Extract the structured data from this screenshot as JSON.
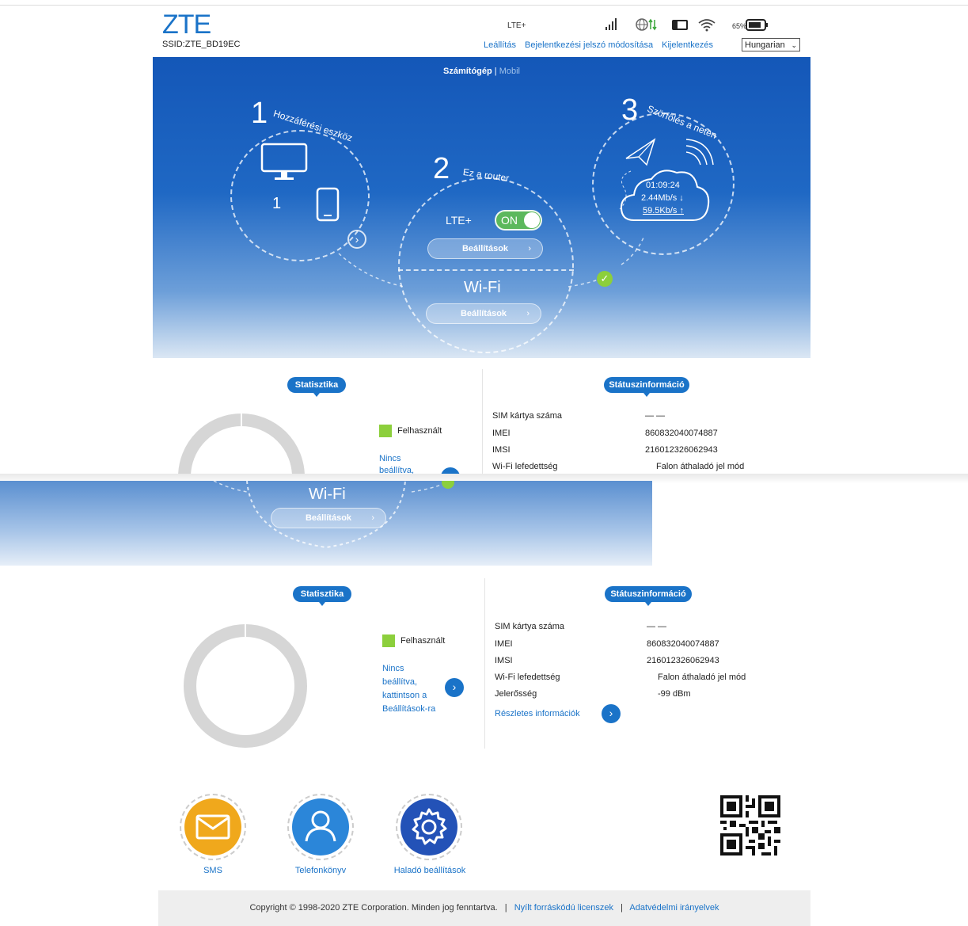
{
  "header": {
    "logo": "ZTE",
    "ssid": "SSID:ZTE_BD19EC",
    "network_type": "LTE+",
    "battery_percent": "65%",
    "links": [
      "Leállítás",
      "Bejelentkezési jelszó módosítása",
      "Kijelentkezés"
    ],
    "language": "Hungarian"
  },
  "mode_switch": {
    "active": "Számítógép",
    "separator": "|",
    "inactive": "Mobil"
  },
  "step1": {
    "number": "1",
    "title": "Hozzáférési eszköz",
    "device_count": "1"
  },
  "step2": {
    "number": "2",
    "title": "Ez a router",
    "lte_label": "LTE+",
    "toggle_label": "ON",
    "settings_label": "Beállítások",
    "wifi_label": "Wi-Fi",
    "wifi_settings_label": "Beállítások"
  },
  "step3": {
    "number": "3",
    "title": "Szörfölés a neten",
    "time": "01:09:24",
    "download": "2.44Mb/s ↓",
    "upload": "59.5Kb/s ↑"
  },
  "statistics": {
    "title": "Statisztika",
    "legend_used": "Felhasznált",
    "not_set_lines": [
      "Nincs",
      "beállítva,",
      "kattintson a",
      "Beállítások-ra"
    ]
  },
  "status": {
    "title": "Státuszinformáció",
    "rows": [
      {
        "label": "SIM kártya száma",
        "value": "— —"
      },
      {
        "label": "IMEI",
        "value": "860832040074887"
      },
      {
        "label": "IMSI",
        "value": "216012326062943"
      },
      {
        "label": "Wi-Fi lefedettség",
        "value": "Falon áthaladó jel mód"
      },
      {
        "label": "Jelerősség",
        "value": "-99 dBm"
      }
    ],
    "details_link": "Részletes információk"
  },
  "apps": [
    {
      "label": "SMS",
      "icon": "envelope-icon",
      "color": "#f0a81c"
    },
    {
      "label": "Telefonkönyv",
      "icon": "person-icon",
      "color": "#2b86d9"
    },
    {
      "label": "Haladó beállítások",
      "icon": "gear-icon",
      "color": "#2352b7"
    }
  ],
  "footer": {
    "copyright": "Copyright © 1998-2020 ZTE Corporation. Minden jog fenntartva.",
    "sep": "|",
    "license_link": "Nyílt forráskódú licenszek",
    "privacy_link": "Adatvédelmi irányelvek"
  },
  "colors": {
    "brand_blue": "#1a73c8",
    "used_green": "#8ccf3c",
    "toggle_green": "#5cb85c"
  }
}
